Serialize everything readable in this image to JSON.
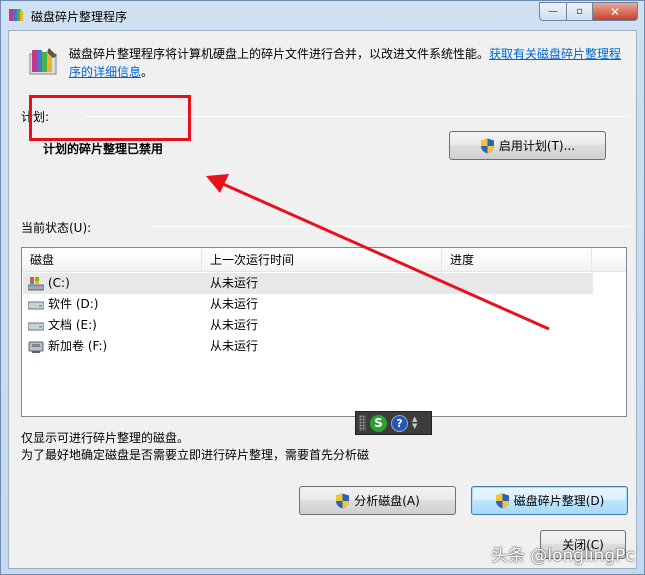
{
  "window": {
    "title": "磁盘碎片整理程序",
    "controls": {
      "minimize": "—",
      "maximize": "▫",
      "close": "✕"
    }
  },
  "description": {
    "text": "磁盘碎片整理程序将计算机硬盘上的碎片文件进行合并，以改进文件系统性能。",
    "link": "获取有关磁盘碎片整理程序的详细信息",
    "tail": "。"
  },
  "schedule": {
    "group_label": "计划:",
    "status": "计划的碎片整理已禁用",
    "enable_button": "启用计划(T)..."
  },
  "current_status": {
    "group_label": "当前状态(U):",
    "columns": [
      "磁盘",
      "上一次运行时间",
      "进度"
    ],
    "rows": [
      {
        "disk": "(C:)",
        "last_run": "从未运行",
        "progress": "",
        "icon": "system-drive-icon"
      },
      {
        "disk": "软件 (D:)",
        "last_run": "从未运行",
        "progress": "",
        "icon": "hard-drive-icon"
      },
      {
        "disk": "文档 (E:)",
        "last_run": "从未运行",
        "progress": "",
        "icon": "hard-drive-icon"
      },
      {
        "disk": "新加卷 (F:)",
        "last_run": "从未运行",
        "progress": "",
        "icon": "removable-drive-icon"
      }
    ]
  },
  "notes": {
    "line1": "仅显示可进行碎片整理的磁盘。",
    "line2": "为了最好地确定磁盘是否需要立即进行碎片整理，需要首先分析磁"
  },
  "ime": {
    "s": "S",
    "help": "?"
  },
  "buttons": {
    "analyze": "分析磁盘(A)",
    "defrag": "磁盘碎片整理(D)",
    "close": "关闭(C)"
  },
  "watermark": "头条 @longlingPc",
  "colors": {
    "annotation_red": "#e8101b",
    "link": "#0066cc"
  }
}
